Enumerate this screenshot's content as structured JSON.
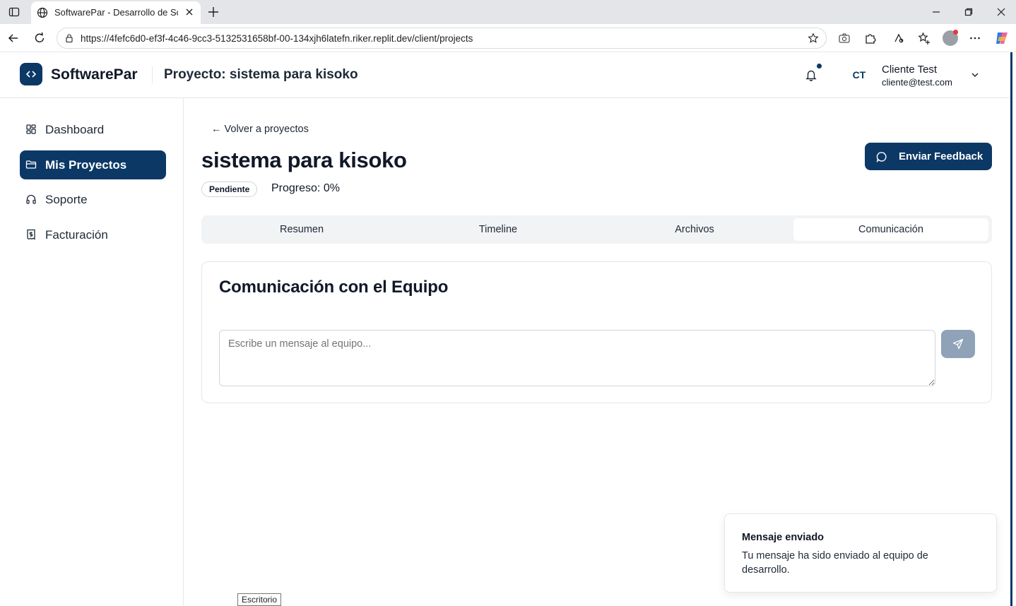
{
  "browser": {
    "tab_title": "SoftwarePar - Desarrollo de Software",
    "url": "https://4fefc6d0-ef3f-4c46-9cc3-5132531658bf-00-134xjh6latefn.riker.replit.dev/client/projects"
  },
  "header": {
    "brand": "SoftwarePar",
    "page_title": "Proyecto: sistema para kisoko",
    "avatar_initials": "CT",
    "user_name": "Cliente Test",
    "user_email": "cliente@test.com"
  },
  "sidebar": {
    "items": [
      {
        "label": "Dashboard",
        "icon": "dashboard-icon",
        "active": false
      },
      {
        "label": "Mis Proyectos",
        "icon": "folder-icon",
        "active": true
      },
      {
        "label": "Soporte",
        "icon": "headphones-icon",
        "active": false
      },
      {
        "label": "Facturación",
        "icon": "receipt-icon",
        "active": false
      }
    ]
  },
  "main": {
    "back_link": "← Volver a proyectos",
    "project_title": "sistema para kisoko",
    "status_badge": "Pendiente",
    "progress_text": "Progreso: 0%",
    "feedback_button": "Enviar Feedback",
    "tabs": [
      {
        "label": "Resumen",
        "active": false
      },
      {
        "label": "Timeline",
        "active": false
      },
      {
        "label": "Archivos",
        "active": false
      },
      {
        "label": "Comunicación",
        "active": true
      }
    ],
    "card": {
      "title": "Comunicación con el Equipo",
      "message_placeholder": "Escribe un mensaje al equipo..."
    }
  },
  "toast": {
    "title": "Mensaje enviado",
    "body": "Tu mensaje ha sido enviado al equipo de desarrollo."
  },
  "taskbar_tooltip": "Escritorio",
  "colors": {
    "primary": "#0c3866",
    "send_disabled": "#8fa2b8",
    "tabs_bg": "#f1f3f5"
  }
}
